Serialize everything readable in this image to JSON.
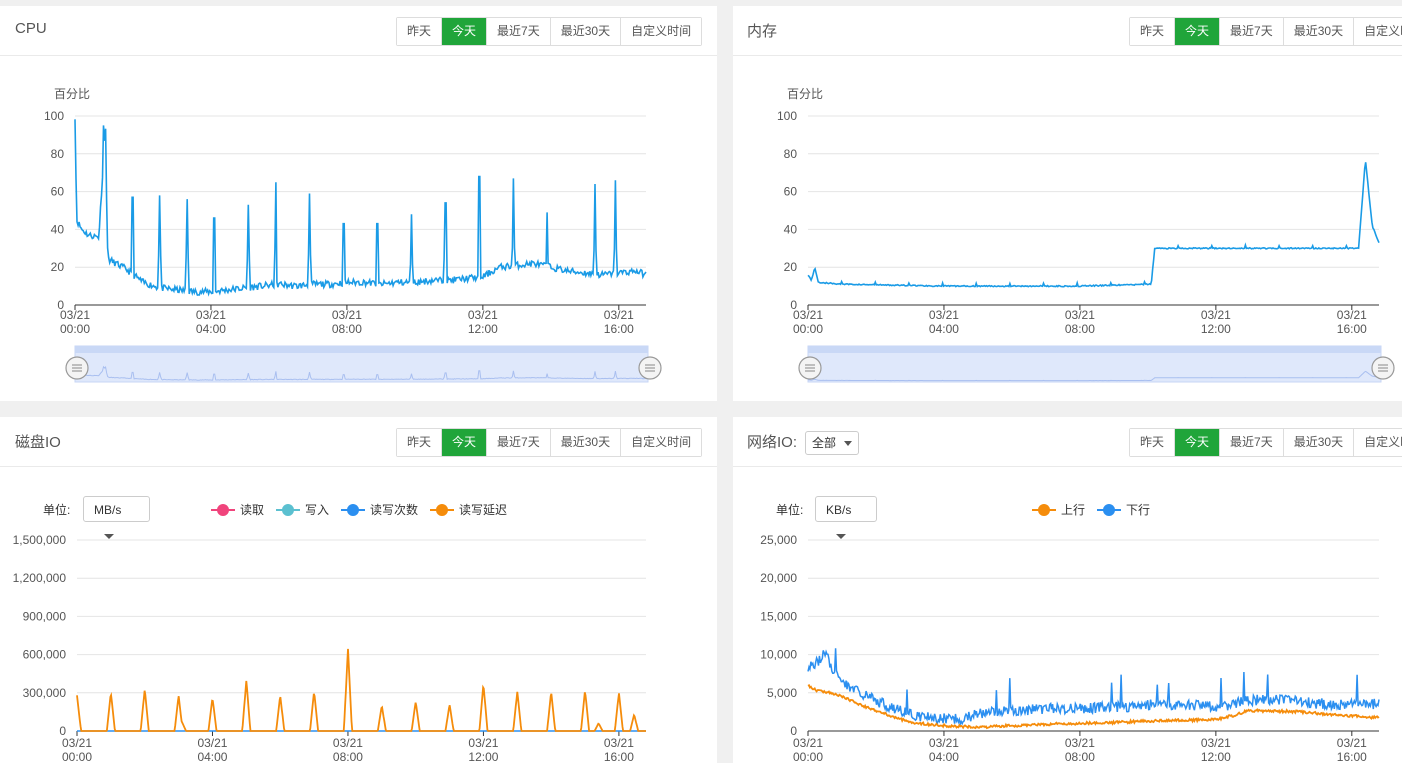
{
  "range_buttons": [
    "昨天",
    "今天",
    "最近7天",
    "最近30天",
    "自定义时间"
  ],
  "active_range": "今天",
  "colors": {
    "accent": "#20a53a",
    "cpu": "#1a9be6",
    "read": "#f0447c",
    "write": "#5bc0d0",
    "rw_count": "#2b8ff0",
    "rw_latency": "#f58c0b",
    "up": "#f58c0b",
    "down": "#2b8ff0"
  },
  "cpu": {
    "title": "CPU"
  },
  "mem": {
    "title": "内存"
  },
  "disk": {
    "title": "磁盘IO",
    "unit_label": "单位:",
    "unit_value": "MB/s",
    "legend": [
      "读取",
      "写入",
      "读写次数",
      "读写延迟"
    ]
  },
  "net": {
    "title": "网络IO:",
    "scope_value": "全部",
    "unit_label": "单位:",
    "unit_value": "KB/s",
    "legend": [
      "上行",
      "下行"
    ]
  },
  "chart_data": [
    {
      "id": "cpu",
      "type": "line",
      "ylabel": "百分比",
      "ylim": [
        0,
        100
      ],
      "yticks": [
        "100",
        "80",
        "60",
        "40",
        "20",
        "0"
      ],
      "xticks": [
        [
          "03/21",
          "00:00"
        ],
        [
          "03/21",
          "04:00"
        ],
        [
          "03/21",
          "08:00"
        ],
        [
          "03/21",
          "12:00"
        ],
        [
          "03/21",
          "16:00"
        ]
      ],
      "grid": true,
      "data_zoom": true,
      "series": [
        {
          "x": [
            0,
            0.05,
            0.2,
            0.4,
            0.7,
            0.9,
            0.95,
            1.0,
            1.5,
            2.0,
            2.5,
            3.0,
            3.5,
            4.0,
            4.5,
            5.0,
            5.5,
            6.0,
            6.5,
            7.0,
            7.5,
            8.0,
            8.5,
            9.0,
            9.5,
            10.0,
            10.5,
            11.0,
            11.5,
            12.0,
            12.5,
            13.0,
            13.5,
            14.0,
            14.5,
            15.0,
            15.5,
            16.0,
            16.5,
            16.8
          ],
          "y": [
            100,
            45,
            40,
            37,
            36,
            95,
            30,
            24,
            19,
            12,
            9,
            8,
            7,
            7,
            8,
            9,
            10,
            11,
            10,
            11,
            11,
            12,
            12,
            11,
            12,
            12,
            13,
            13,
            14,
            15,
            20,
            21,
            22,
            20,
            18,
            17,
            16,
            17,
            18,
            16
          ]
        }
      ]
    },
    {
      "id": "mem",
      "type": "line",
      "ylabel": "百分比",
      "ylim": [
        0,
        100
      ],
      "yticks": [
        "100",
        "80",
        "60",
        "40",
        "20",
        "0"
      ],
      "xticks": [
        [
          "03/21",
          "00:00"
        ],
        [
          "03/21",
          "04:00"
        ],
        [
          "03/21",
          "08:00"
        ],
        [
          "03/21",
          "12:00"
        ],
        [
          "03/21",
          "16:00"
        ]
      ],
      "grid": true,
      "data_zoom": true,
      "series": [
        {
          "x": [
            0,
            0.1,
            0.2,
            0.3,
            1,
            4,
            8,
            10.1,
            10.2,
            12,
            15,
            16.2,
            16.4,
            16.6,
            16.8
          ],
          "y": [
            16,
            13,
            20,
            12,
            11,
            10,
            10,
            11,
            30,
            30,
            30,
            30,
            77,
            42,
            33
          ]
        }
      ]
    },
    {
      "id": "disk",
      "type": "line",
      "ylim": [
        0,
        1500000
      ],
      "yticks": [
        "1,500,000",
        "1,200,000",
        "900,000",
        "600,000",
        "300,000",
        "0"
      ],
      "xticks": [
        [
          "03/21",
          "00:00"
        ],
        [
          "03/21",
          "04:00"
        ],
        [
          "03/21",
          "08:00"
        ],
        [
          "03/21",
          "12:00"
        ],
        [
          "03/21",
          "16:00"
        ]
      ],
      "grid": true,
      "series": [
        {
          "name": "读取",
          "values": [
            0
          ]
        },
        {
          "name": "写入",
          "values": [
            0
          ]
        },
        {
          "name": "读写次数",
          "values": [
            0
          ]
        },
        {
          "name": "读写延迟",
          "peaks_x": [
            0,
            1,
            2,
            3,
            3.1,
            4,
            5,
            6,
            7,
            8,
            9,
            10,
            11,
            12,
            13,
            14,
            15,
            15.4,
            16,
            16.45
          ],
          "peaks_y": [
            280000,
            300000,
            330000,
            280000,
            70000,
            260000,
            400000,
            280000,
            310000,
            650000,
            200000,
            230000,
            210000,
            370000,
            310000,
            310000,
            320000,
            60000,
            300000,
            130000
          ]
        }
      ]
    },
    {
      "id": "net",
      "type": "line",
      "ylim": [
        0,
        25000
      ],
      "yticks": [
        "25,000",
        "20,000",
        "15,000",
        "10,000",
        "5,000",
        "0"
      ],
      "xticks": [
        [
          "03/21",
          "00:00"
        ],
        [
          "03/21",
          "04:00"
        ],
        [
          "03/21",
          "08:00"
        ],
        [
          "03/21",
          "12:00"
        ],
        [
          "03/21",
          "16:00"
        ]
      ],
      "grid": true,
      "series": [
        {
          "name": "上行",
          "x": [
            0,
            0.3,
            0.7,
            1,
            1.5,
            2,
            2.5,
            3,
            3.5,
            4,
            4.5,
            5,
            6,
            7,
            8,
            9,
            10,
            10.5,
            11,
            12,
            12.5,
            13,
            13.5,
            14,
            14.5,
            15,
            15.5,
            16,
            16.5,
            16.8
          ],
          "y": [
            6000,
            5200,
            5000,
            4500,
            3500,
            2700,
            1800,
            1200,
            900,
            700,
            600,
            500,
            700,
            900,
            1000,
            1100,
            1300,
            1400,
            1400,
            1500,
            2000,
            2700,
            2600,
            2600,
            2500,
            2300,
            2100,
            2000,
            1800,
            1800
          ]
        },
        {
          "name": "下行",
          "x": [
            0,
            0.3,
            0.5,
            0.7,
            1,
            1.5,
            2,
            2.5,
            3,
            3.5,
            4,
            4.5,
            5,
            6,
            7,
            8,
            9,
            10,
            10.5,
            11,
            12,
            12.5,
            13,
            13.5,
            14,
            14.5,
            15,
            15.5,
            16,
            16.5,
            16.8
          ],
          "y": [
            8500,
            9000,
            10500,
            8000,
            6500,
            5000,
            4000,
            3000,
            2200,
            1800,
            1600,
            1500,
            2200,
            2700,
            2900,
            3000,
            3100,
            3400,
            3500,
            3400,
            3200,
            3500,
            4000,
            4200,
            4000,
            3800,
            3600,
            3500,
            3400,
            3300,
            3800
          ]
        }
      ]
    }
  ]
}
